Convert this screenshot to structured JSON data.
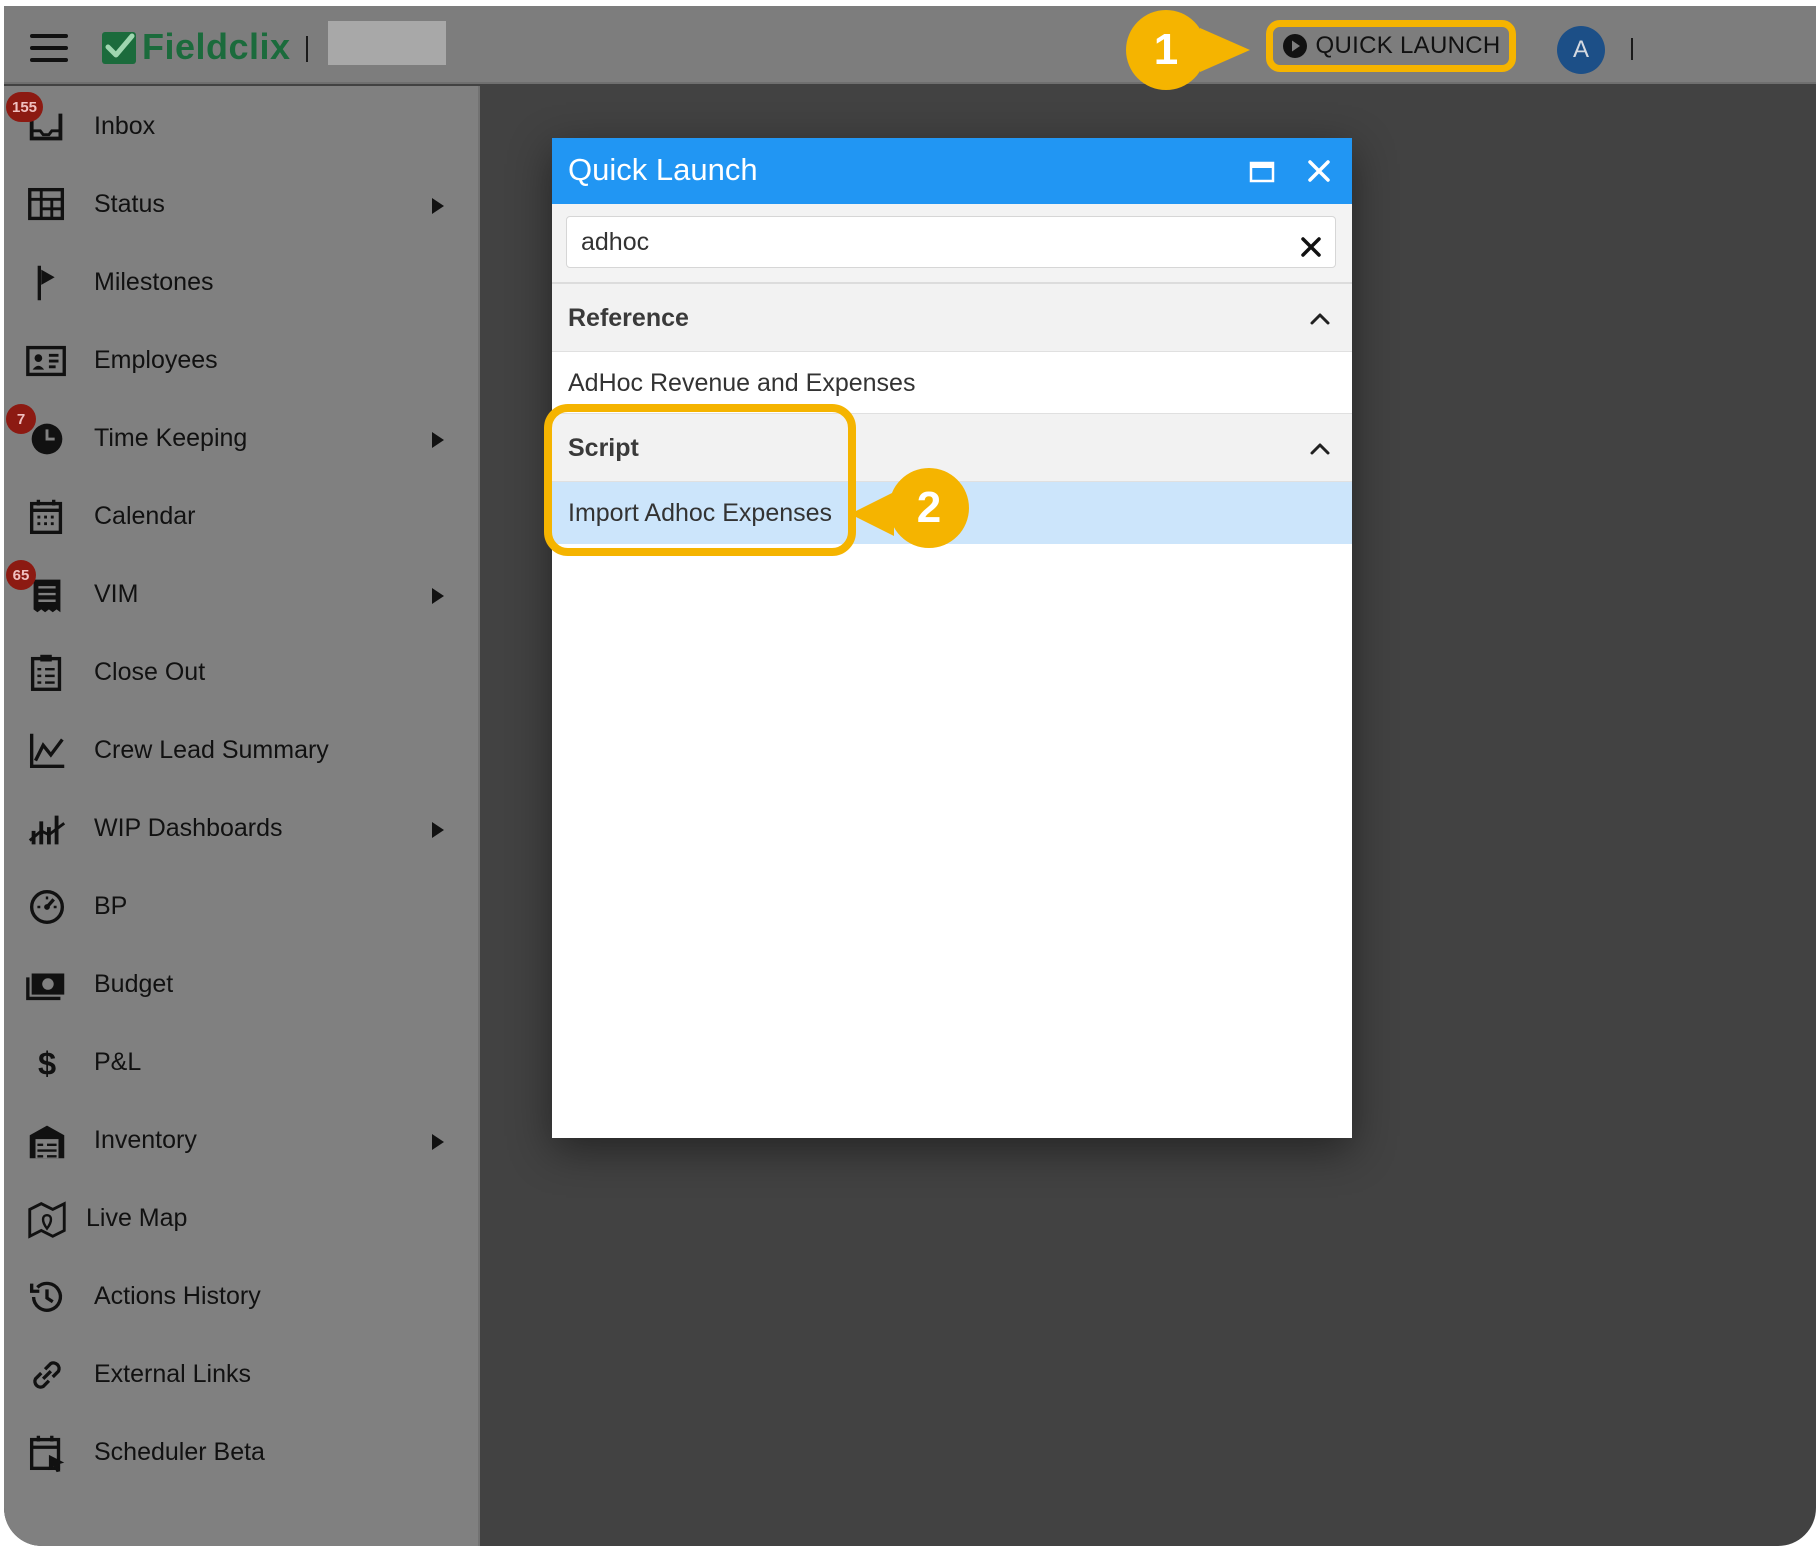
{
  "app": {
    "logo_text": "Fieldclix",
    "brand_color": "#1b6b3c",
    "accent_color": "#f5b400"
  },
  "topbar": {
    "quick_launch_label": "QUICK LAUNCH",
    "avatar_initial": "A"
  },
  "callouts": {
    "first": "1",
    "second": "2"
  },
  "sidebar": {
    "items": [
      {
        "label": "Inbox",
        "icon": "inbox-icon",
        "badge": "155",
        "submenu": false
      },
      {
        "label": "Status",
        "icon": "status-icon",
        "badge": "",
        "submenu": true
      },
      {
        "label": "Milestones",
        "icon": "flag-icon",
        "badge": "",
        "submenu": false
      },
      {
        "label": "Employees",
        "icon": "id-card-icon",
        "badge": "",
        "submenu": false
      },
      {
        "label": "Time Keeping",
        "icon": "clock-icon",
        "badge": "7",
        "submenu": true
      },
      {
        "label": "Calendar",
        "icon": "calendar-icon",
        "badge": "",
        "submenu": false
      },
      {
        "label": "VIM",
        "icon": "receipt-icon",
        "badge": "65",
        "submenu": true
      },
      {
        "label": "Close Out",
        "icon": "clipboard-icon",
        "badge": "",
        "submenu": false
      },
      {
        "label": "Crew Lead Summary",
        "icon": "line-chart-icon",
        "badge": "",
        "submenu": false
      },
      {
        "label": "WIP Dashboards",
        "icon": "bar-chart-icon",
        "badge": "",
        "submenu": true
      },
      {
        "label": "BP",
        "icon": "gauge-icon",
        "badge": "",
        "submenu": false
      },
      {
        "label": "Budget",
        "icon": "money-icon",
        "badge": "",
        "submenu": false
      },
      {
        "label": "P&L",
        "icon": "dollar-icon",
        "badge": "",
        "submenu": false
      },
      {
        "label": "Inventory",
        "icon": "warehouse-icon",
        "badge": "",
        "submenu": true
      },
      {
        "label": "Live Map",
        "icon": "map-icon",
        "badge": "",
        "submenu": false
      },
      {
        "label": "Actions History",
        "icon": "history-icon",
        "badge": "",
        "submenu": false
      },
      {
        "label": "External Links",
        "icon": "link-icon",
        "badge": "",
        "submenu": false
      },
      {
        "label": "Scheduler Beta",
        "icon": "scheduler-icon",
        "badge": "",
        "submenu": false
      }
    ]
  },
  "dialog": {
    "title": "Quick Launch",
    "search_value": "adhoc",
    "groups": [
      {
        "title": "Reference",
        "items": [
          "AdHoc Revenue and Expenses"
        ]
      },
      {
        "title": "Script",
        "items": [
          "Import Adhoc Expenses"
        ]
      }
    ],
    "selected_item": "Import Adhoc Expenses",
    "header_color": "#2196f3",
    "selected_color": "#cce5fb"
  }
}
